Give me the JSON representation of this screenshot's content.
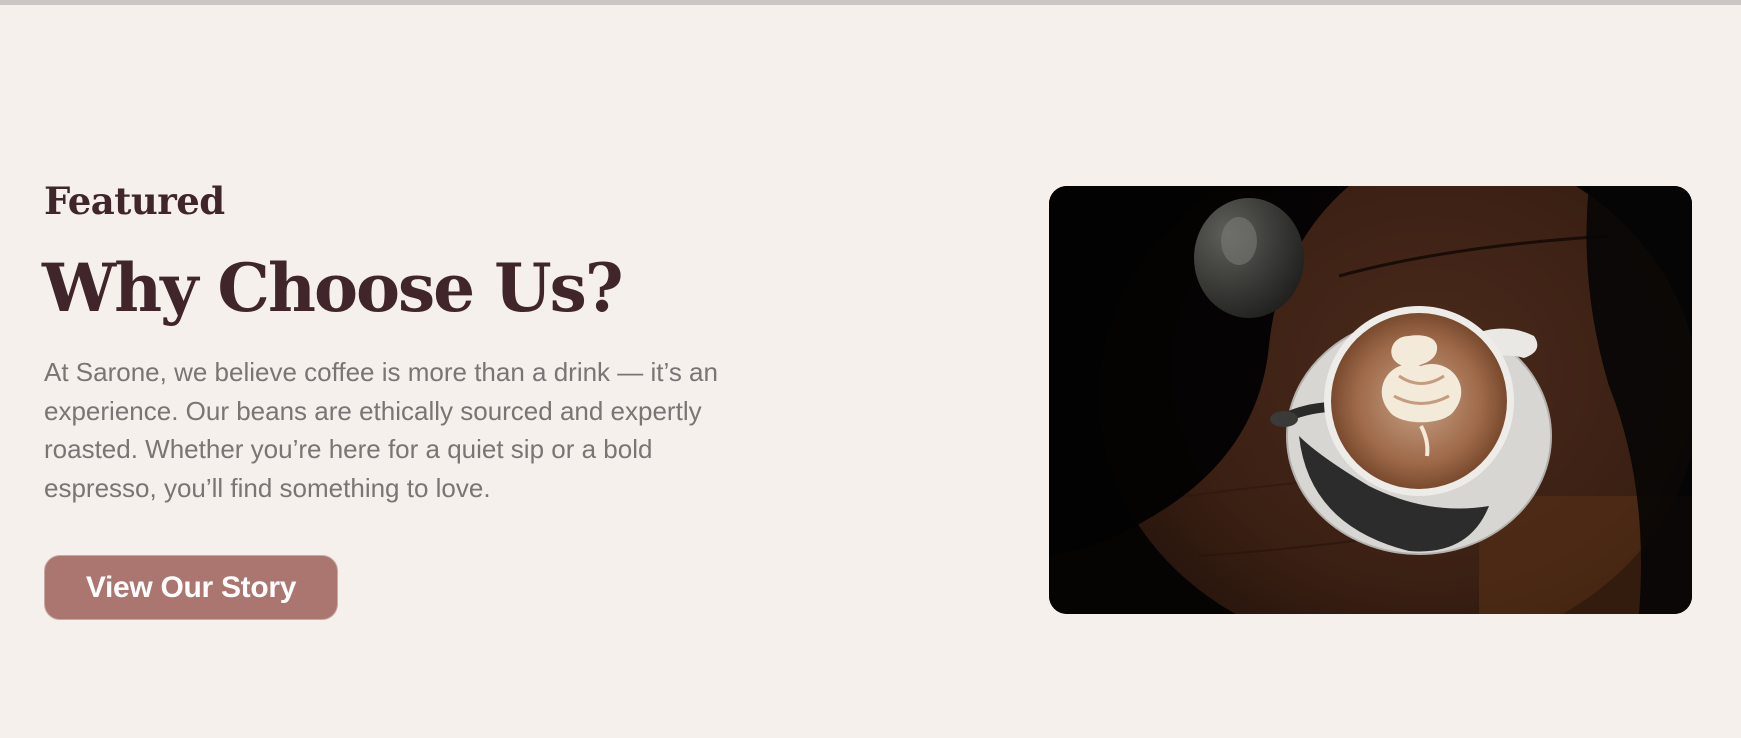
{
  "featured_section": {
    "eyebrow": "Featured",
    "heading": "Why Choose Us?",
    "body": "At Sarone, we believe coffee is more than a drink — it’s an experience. Our beans are ethically sourced and expertly roasted. Whether you’re here for a quiet sip or a bold espresso, you’ll find something to love.",
    "cta_label": "View Our Story"
  },
  "colors": {
    "background": "#f5f0ec",
    "heading": "#40262a",
    "body_text": "#7a7474",
    "button": "#ab766f",
    "button_text": "#ffffff"
  },
  "photo": {
    "subject": "latte with leaf art on a dark wooden table",
    "icon": "coffee-cup-image"
  }
}
